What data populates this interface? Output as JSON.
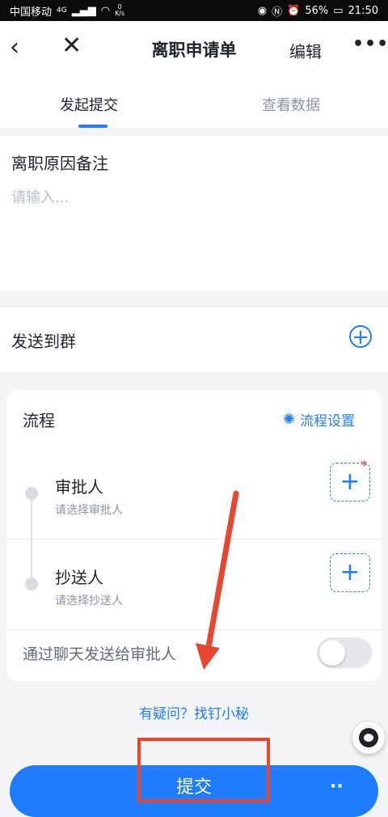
{
  "status_bar": {
    "carrier": "中国移动",
    "network": "4G",
    "speed_value": "0",
    "speed_unit": "K/s",
    "battery": "56%",
    "time": "21:50"
  },
  "header": {
    "title": "离职申请单",
    "edit_label": "编辑",
    "more_label": "•••"
  },
  "tabs": [
    {
      "label": "发起提交",
      "active": true
    },
    {
      "label": "查看数据",
      "active": false
    }
  ],
  "note_section": {
    "label": "离职原因备注",
    "placeholder": "请输入..."
  },
  "send_group": {
    "label": "发送到群"
  },
  "flow": {
    "title": "流程",
    "settings_label": "流程设置",
    "approver": {
      "label": "审批人",
      "hint": "请选择审批人",
      "required": true
    },
    "cc": {
      "label": "抄送人",
      "hint": "请选择抄送人"
    },
    "chat_toggle": {
      "label": "通过聊天发送给审批人",
      "on": false
    }
  },
  "help_link": "有疑问？找钉小秘",
  "submit_label": "提交",
  "accent_color": "#1f7cff",
  "annotation_color": "#e8462f"
}
